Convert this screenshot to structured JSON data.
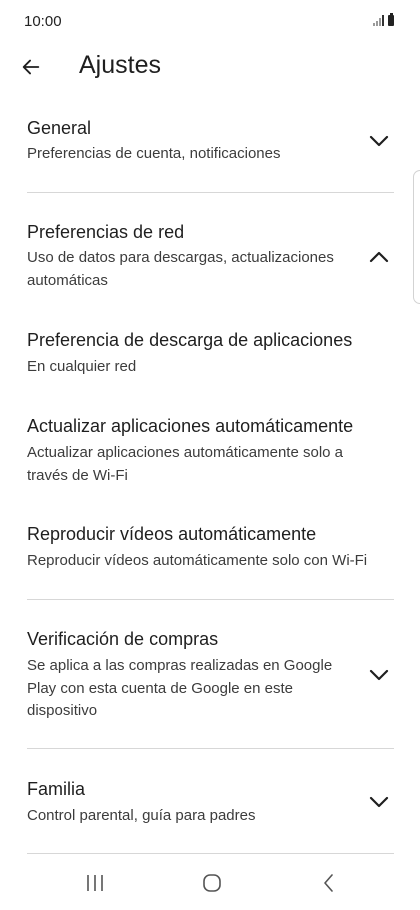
{
  "status_bar": {
    "time": "10:00"
  },
  "header": {
    "title": "Ajustes"
  },
  "sections": [
    {
      "title": "General",
      "subtitle": "Preferencias de cuenta, notificaciones",
      "expanded": false
    },
    {
      "title": "Preferencias de red",
      "subtitle": "Uso de datos para descargas, actualizaciones automáticas",
      "expanded": true,
      "children": [
        {
          "title": "Preferencia de descarga de aplicaciones",
          "subtitle": "En cualquier red"
        },
        {
          "title": "Actualizar aplicaciones automáticamente",
          "subtitle": "Actualizar aplicaciones automáticamente solo a través de Wi-Fi"
        },
        {
          "title": "Reproducir vídeos automáticamente",
          "subtitle": "Reproducir vídeos automáticamente solo con Wi-Fi"
        }
      ]
    },
    {
      "title": "Verificación de compras",
      "subtitle": "Se aplica a las compras realizadas en Google Play con esta cuenta de Google en este dispositivo",
      "expanded": false
    },
    {
      "title": "Familia",
      "subtitle": "Control parental, guía para padres",
      "expanded": false
    }
  ],
  "icons": {
    "back": "arrow-left-icon",
    "collapsed": "chevron-down-icon",
    "expanded": "chevron-up-icon",
    "nav_recents": "recents-icon",
    "nav_home": "home-icon",
    "nav_back": "nav-back-icon"
  },
  "colors": {
    "text_primary": "#1f1f1f",
    "text_secondary": "#3c3c3c",
    "divider": "#d7d7d7",
    "background": "#ffffff"
  }
}
